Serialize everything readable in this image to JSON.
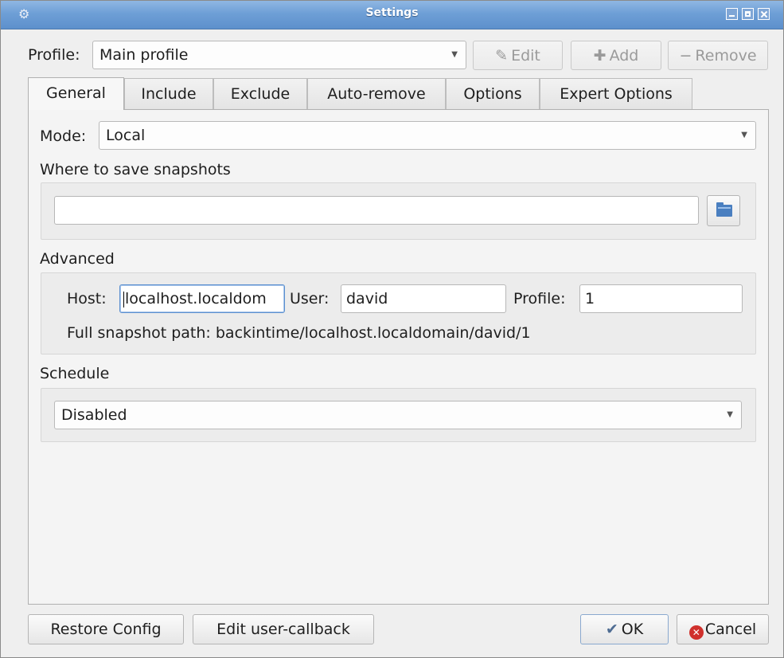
{
  "window": {
    "title": "Settings"
  },
  "profile_bar": {
    "label": "Profile:",
    "selected": "Main profile",
    "edit_label": "Edit",
    "add_label": "Add",
    "remove_label": "Remove"
  },
  "tabs": [
    {
      "label": "General",
      "active": true
    },
    {
      "label": "Include",
      "active": false
    },
    {
      "label": "Exclude",
      "active": false
    },
    {
      "label": "Auto-remove",
      "active": false
    },
    {
      "label": "Options",
      "active": false
    },
    {
      "label": "Expert Options",
      "active": false
    }
  ],
  "general": {
    "mode_label": "Mode:",
    "mode_value": "Local",
    "where_label": "Where to save snapshots",
    "where_value": "",
    "advanced_label": "Advanced",
    "host_label": "Host:",
    "host_value": "localhost.localdom",
    "user_label": "User:",
    "user_value": "david",
    "profile_label": "Profile:",
    "profile_value": "1",
    "full_path": "Full snapshot path: backintime/localhost.localdomain/david/1",
    "schedule_label": "Schedule",
    "schedule_value": "Disabled"
  },
  "footer": {
    "restore_label": "Restore Config",
    "callback_label": "Edit user-callback",
    "ok_label": "OK",
    "cancel_label": "Cancel"
  },
  "icons": {
    "edit": "pencil-icon",
    "add": "plus-icon",
    "remove": "minus-icon",
    "ok": "checkmark-icon",
    "cancel": "cancel-icon",
    "folder": "folder-icon"
  },
  "colors": {
    "titlebar": "#6e9fd6",
    "focus": "#5b8fcf",
    "cancel_red": "#d0312d",
    "folder_blue": "#4a7fc0"
  }
}
